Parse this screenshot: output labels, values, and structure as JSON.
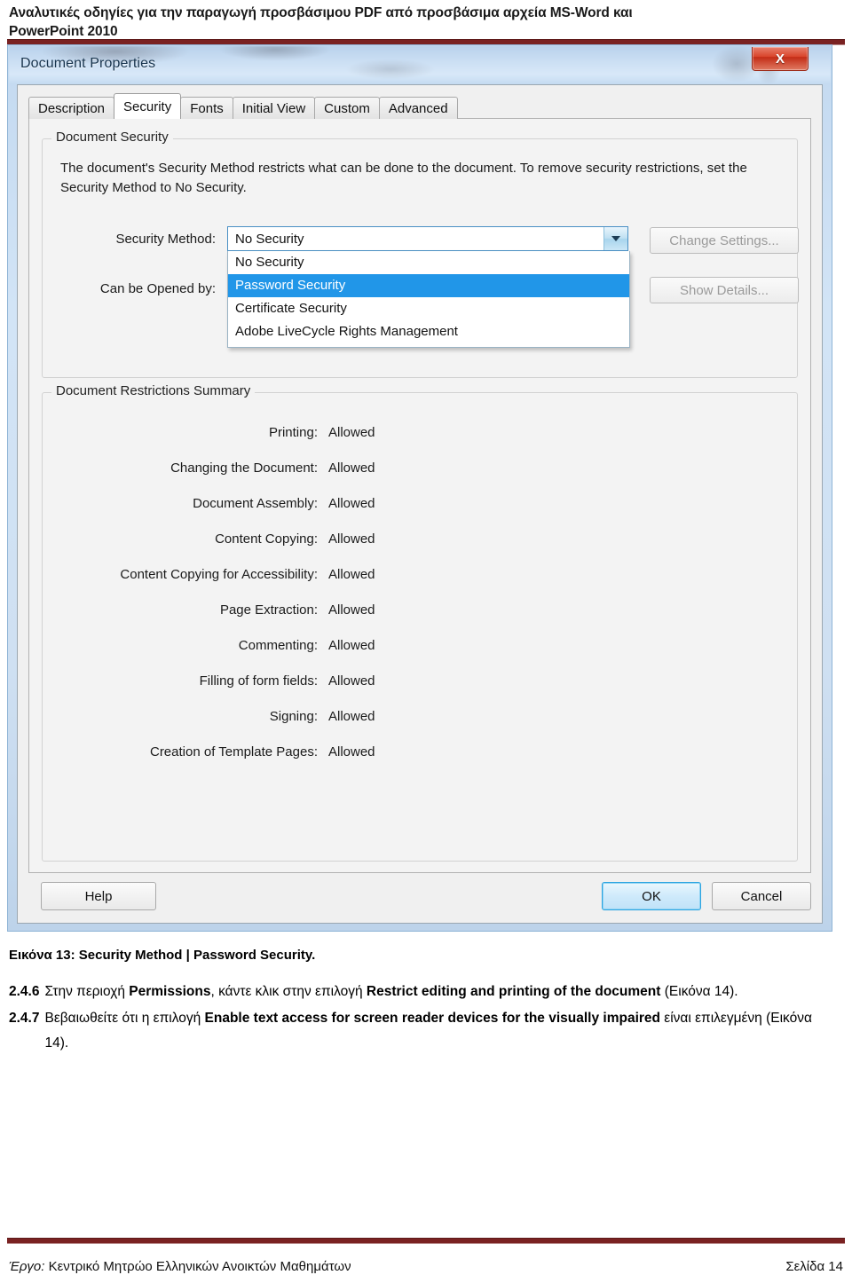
{
  "page_header": {
    "line1": "Αναλυτικές οδηγίες για την παραγωγή προσβάσιμου PDF από προσβάσιμα αρχεία MS-Word και",
    "line2": "PowerPoint 2010"
  },
  "dialog": {
    "title": "Document Properties",
    "close_label": "X",
    "tabs": [
      {
        "label": "Description",
        "active": false
      },
      {
        "label": "Security",
        "active": true
      },
      {
        "label": "Fonts",
        "active": false
      },
      {
        "label": "Initial View",
        "active": false
      },
      {
        "label": "Custom",
        "active": false
      },
      {
        "label": "Advanced",
        "active": false
      }
    ],
    "document_security": {
      "legend": "Document Security",
      "description": "The document's Security Method restricts what can be done to the document. To remove security restrictions, set the Security Method to No Security.",
      "security_method_label": "Security Method:",
      "security_method_value": "No Security",
      "can_be_opened_by_label": "Can be Opened by:",
      "dropdown_options": [
        {
          "label": "No Security",
          "selected": false
        },
        {
          "label": "Password Security",
          "selected": true
        },
        {
          "label": "Certificate Security",
          "selected": false
        },
        {
          "label": "Adobe LiveCycle Rights Management",
          "selected": false
        }
      ],
      "change_settings_label": "Change Settings...",
      "show_details_label": "Show Details..."
    },
    "restrictions": {
      "legend": "Document Restrictions Summary",
      "rows": [
        {
          "name": "Printing:",
          "value": "Allowed"
        },
        {
          "name": "Changing the Document:",
          "value": "Allowed"
        },
        {
          "name": "Document Assembly:",
          "value": "Allowed"
        },
        {
          "name": "Content Copying:",
          "value": "Allowed"
        },
        {
          "name": "Content Copying for Accessibility:",
          "value": "Allowed"
        },
        {
          "name": "Page Extraction:",
          "value": "Allowed"
        },
        {
          "name": "Commenting:",
          "value": "Allowed"
        },
        {
          "name": "Filling of form fields:",
          "value": "Allowed"
        },
        {
          "name": "Signing:",
          "value": "Allowed"
        },
        {
          "name": "Creation of Template Pages:",
          "value": "Allowed"
        }
      ]
    },
    "buttons": {
      "help": "Help",
      "ok": "OK",
      "cancel": "Cancel"
    }
  },
  "caption": "Εικόνα 13: Security Method | Password Security.",
  "steps": [
    {
      "number": "2.4.6",
      "parts": [
        {
          "text": "Στην περιοχή ",
          "bold": false
        },
        {
          "text": "Permissions",
          "bold": true
        },
        {
          "text": ", κάντε κλικ στην επιλογή ",
          "bold": false
        },
        {
          "text": "Restrict editing and printing of the document",
          "bold": true
        },
        {
          "text": " (Εικόνα 14).",
          "bold": false
        }
      ]
    },
    {
      "number": "2.4.7",
      "parts": [
        {
          "text": "Βεβαιωθείτε ότι η επιλογή ",
          "bold": false
        },
        {
          "text": "Enable text access for screen reader devices for the visually impaired",
          "bold": true
        },
        {
          "text": " είναι επιλεγμένη (Εικόνα 14).",
          "bold": false
        }
      ]
    }
  ],
  "footer": {
    "project_prefix": "Έργο:",
    "project_name": " Κεντρικό Μητρώο Ελληνικών Ανοικτών Μαθημάτων",
    "page": "Σελίδα 14"
  },
  "colors": {
    "accent_rule": "#7a2222",
    "selection_blue": "#2196e8",
    "ok_border": "#2aa3e0",
    "close_red": "#d9452b"
  }
}
